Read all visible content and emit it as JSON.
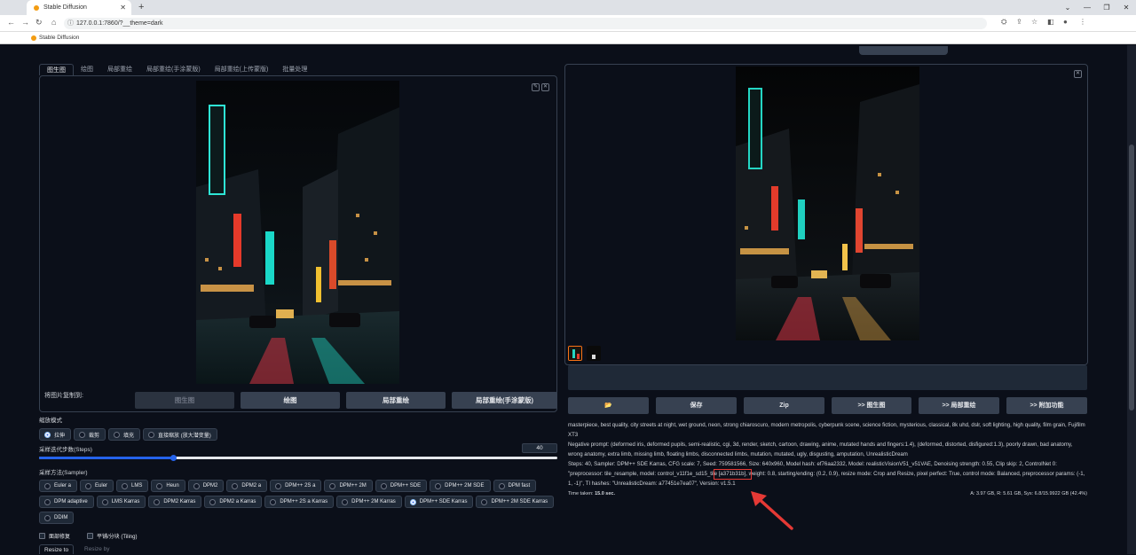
{
  "browser": {
    "tab_title": "Stable Diffusion",
    "url": "127.0.0.1:7860/?__theme=dark",
    "bookmark": "Stable Diffusion"
  },
  "tabs": [
    {
      "label": "图生图",
      "active": true
    },
    {
      "label": "绘图",
      "active": false
    },
    {
      "label": "局部重绘",
      "active": false
    },
    {
      "label": "局部重绘(手涂蒙版)",
      "active": false
    },
    {
      "label": "局部重绘(上传蒙版)",
      "active": false
    },
    {
      "label": "批量处理",
      "active": false
    }
  ],
  "copy_to": {
    "label": "将图片复制到:",
    "buttons": [
      "图生图",
      "绘图",
      "局部重绘",
      "局部重绘(手涂蒙版)"
    ]
  },
  "resize_mode": {
    "label": "缩放模式",
    "options": [
      "拉伸",
      "裁剪",
      "填充",
      "直接缩放 (放大潜变量)"
    ],
    "selected": "拉伸"
  },
  "steps": {
    "label": "采样迭代步数(Steps)",
    "value": "40",
    "fraction": 0.26
  },
  "sampler": {
    "label": "采样方法(Sampler)",
    "rows": [
      [
        "Euler a",
        "Euler",
        "LMS",
        "Heun",
        "DPM2",
        "DPM2 a",
        "DPM++ 2S a",
        "DPM++ 2M",
        "DPM++ SDE",
        "DPM++ 2M SDE",
        "DPM fast"
      ],
      [
        "DPM adaptive",
        "LMS Karras",
        "DPM2 Karras",
        "DPM2 a Karras",
        "DPM++ 2S a Karras",
        "DPM++ 2M Karras",
        "DPM++ SDE Karras",
        "DPM++ 2M SDE Karras"
      ],
      [
        "DDIM"
      ]
    ],
    "selected": "DPM++ SDE Karras"
  },
  "checks": {
    "face_restore": "面部修复",
    "tiling": "平铺/分块 (Tiling)"
  },
  "resize_tabs": [
    "Resize to",
    "Resize by"
  ],
  "actions": [
    "📂",
    "保存",
    "Zip",
    ">> 图生图",
    ">> 局部重绘",
    ">> 附加功能"
  ],
  "generation_info": {
    "prompt": "masterpiece, best quality, city streets at night, wet ground, neon, strong chiaroscuro, modern metropolis, cyberpunk scene, science fiction, mysterious, classical, 8k uhd, dslr, soft lighting, high quality, film grain, Fujifilm XT3",
    "negative": "Negative prompt: (deformed iris, deformed pupils, semi-realistic, cgi, 3d, render, sketch, cartoon, drawing, anime, mutated hands and fingers:1.4), (deformed, distorted, disfigured:1.3), poorly drawn, bad anatomy, wrong anatomy, extra limb, missing limb, floating limbs, disconnected limbs, mutation, mutated, ugly, disgusting, amputation, UnrealisticDream",
    "params": "Steps: 40, Sampler: DPM++ SDE Karras, CFG scale: 7, Seed: 759581566, Size: 640x960, Model hash: ef76aa2332, Model: realisticVisionV51_v51VAE, Denoising strength: 0.55, Clip skip: 2, ControlNet 0: \"preprocessor: tile_resample, model: control_v11f1e_sd15_tile [a371b31b], weight: 0.8, starting/ending: (0.2, 0.9), resize mode: Crop and Resize, pixel perfect: True, control mode: Balanced, preprocessor params: (-1, 1, -1)\", TI hashes: \"UnrealisticDream: a77451e7ea07\", Version: v1.5.1"
  },
  "time_taken": {
    "label": "Time taken:",
    "value": "15.0 sec.",
    "vram": "A: 3.97 GB, R: 5.61 GB, Sys: 6.8/15.9922 GB (42.4%)"
  },
  "colors": {
    "bg": "#0b0f19",
    "button": "#374151",
    "accent": "#2563eb",
    "highlight": "#e53935"
  }
}
